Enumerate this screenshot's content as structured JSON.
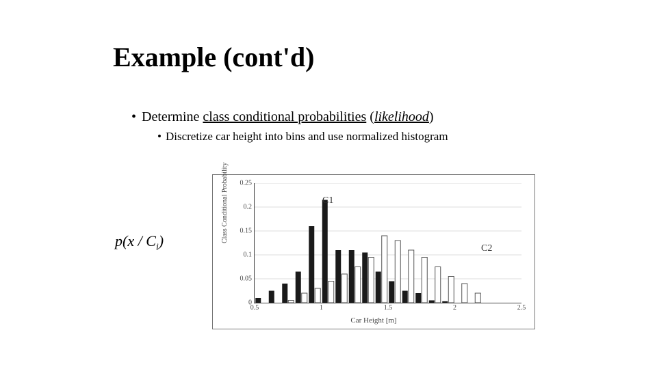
{
  "title": "Example (cont'd)",
  "bullet1_pre": "Determine ",
  "bullet1_mid": "class conditional probabilities",
  "bullet1_paren_open": " (",
  "bullet1_italic": "likelihood",
  "bullet1_paren_close": ")",
  "bullet2": "Discretize car height into bins and use normalized histogram",
  "formula": "p(x / C",
  "formula_sub": "i",
  "formula_close": ")",
  "chart_data": {
    "type": "bar",
    "title": "",
    "xlabel": "Car Height [m]",
    "ylabel": "Class Conditional Probability",
    "xlim": [
      0.5,
      2.5
    ],
    "ylim": [
      0,
      0.25
    ],
    "yticks": [
      0,
      0.05,
      0.1,
      0.15,
      0.2,
      0.25
    ],
    "xticks": [
      0.5,
      1.0,
      1.5,
      2.0,
      2.5
    ],
    "x": [
      0.55,
      0.65,
      0.75,
      0.85,
      0.95,
      1.05,
      1.15,
      1.25,
      1.35,
      1.45,
      1.55,
      1.65,
      1.75,
      1.85,
      1.95,
      2.05,
      2.15
    ],
    "series": [
      {
        "name": "C1",
        "values": [
          0.01,
          0.025,
          0.04,
          0.065,
          0.16,
          0.215,
          0.11,
          0.11,
          0.105,
          0.065,
          0.045,
          0.025,
          0.02,
          0.005,
          0.003,
          0,
          0
        ]
      },
      {
        "name": "C2",
        "values": [
          0,
          0,
          0.005,
          0.02,
          0.03,
          0.045,
          0.06,
          0.075,
          0.095,
          0.14,
          0.13,
          0.11,
          0.095,
          0.075,
          0.055,
          0.04,
          0.02
        ]
      }
    ],
    "annotations": [
      {
        "text": "C1"
      },
      {
        "text": "C2"
      }
    ]
  }
}
